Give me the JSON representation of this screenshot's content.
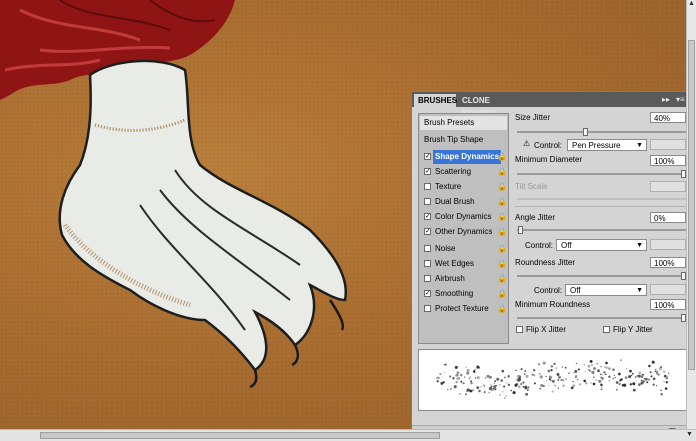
{
  "tabs": {
    "brushes": "BRUSHES",
    "clone_source": "CLONE SOURCE"
  },
  "panel_icons": {
    "collapse": "▸▸",
    "menu": "▾≡"
  },
  "left": {
    "brush_presets": "Brush Presets",
    "brush_tip_shape": "Brush Tip Shape",
    "options": [
      {
        "label": "Shape Dynamics",
        "checked": true,
        "selected": true
      },
      {
        "label": "Scattering",
        "checked": true
      },
      {
        "label": "Texture",
        "checked": false
      },
      {
        "label": "Dual Brush",
        "checked": false
      },
      {
        "label": "Color Dynamics",
        "checked": true
      },
      {
        "label": "Other Dynamics",
        "checked": true
      },
      {
        "label": "Noise",
        "checked": false
      },
      {
        "label": "Wet Edges",
        "checked": false
      },
      {
        "label": "Airbrush",
        "checked": false
      },
      {
        "label": "Smoothing",
        "checked": true
      },
      {
        "label": "Protect Texture",
        "checked": false
      }
    ]
  },
  "settings": {
    "size_jitter": {
      "label": "Size Jitter",
      "value": "40%",
      "fraction": 0.4
    },
    "control_1": {
      "label": "Control:",
      "value": "Pen Pressure"
    },
    "min_diameter": {
      "label": "Minimum Diameter",
      "value": "100%",
      "fraction": 1.0
    },
    "tilt_scale": {
      "label": "Tilt Scale"
    },
    "angle_jitter": {
      "label": "Angle Jitter",
      "value": "0%",
      "fraction": 0.0
    },
    "control_2": {
      "label": "Control:",
      "value": "Off"
    },
    "roundness_jitter": {
      "label": "Roundness Jitter",
      "value": "100%",
      "fraction": 1.0
    },
    "control_3": {
      "label": "Control:",
      "value": "Off"
    },
    "min_roundness": {
      "label": "Minimum Roundness",
      "value": "100%",
      "fraction": 1.0
    },
    "flip_x": "Flip X Jitter",
    "flip_y": "Flip Y Jitter"
  },
  "colors": {
    "canvas": "#a86d30",
    "fur": "#e9ebe6",
    "hair": "#8f1515",
    "selection": "#3875d7"
  }
}
